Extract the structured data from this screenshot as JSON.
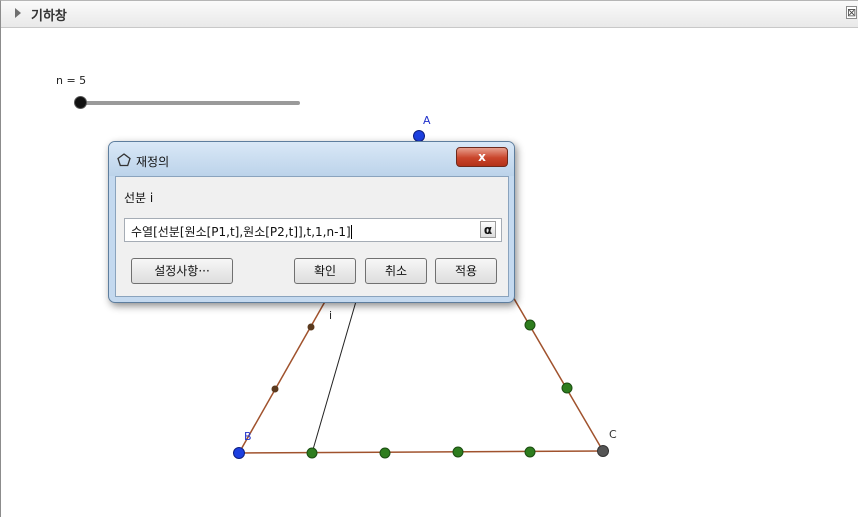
{
  "view": {
    "title": "기하창",
    "close_glyph": "⊠"
  },
  "slider": {
    "label": "n = 5",
    "value": 5,
    "position_fraction": 0.0
  },
  "points": {
    "A": "A",
    "B": "B",
    "C": "C",
    "segment_label": "i"
  },
  "dialog": {
    "title": "재정의",
    "close_label": "x",
    "caption": "선분 i",
    "input_value": "수열[선분[원소[P1,t],원소[P2,t]],t,1,n-1]",
    "alpha_label": "α",
    "buttons": {
      "settings": "설정사항···",
      "ok": "확인",
      "cancel": "취소",
      "apply": "적용"
    }
  },
  "colors": {
    "edge": "#a0522d",
    "green_point": "#2e7d1e",
    "blue_point": "#1c3fe0",
    "gray_point": "#555555",
    "brown_point": "#5b3a1e",
    "label_blue": "#2233cc"
  },
  "icons": {
    "collapse": "triangle-right-icon",
    "dialog": "pentagon-icon",
    "close": "close-icon"
  }
}
